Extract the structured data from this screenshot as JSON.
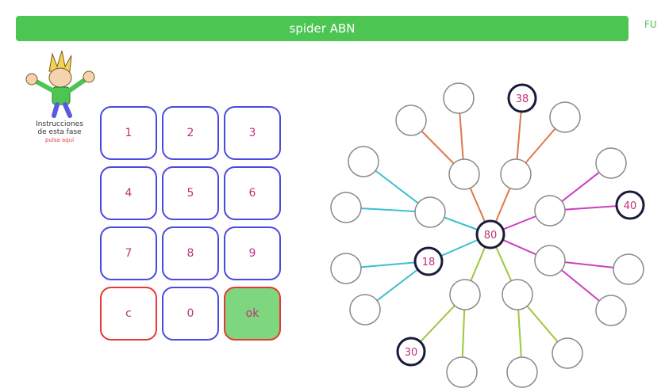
{
  "header": {
    "title": "spider ABN",
    "corner_label": "FU"
  },
  "instructions": {
    "line1": "Instrucciones",
    "line2": "de esta fase",
    "hint": "pulsa aquí"
  },
  "keypad": {
    "keys": [
      "1",
      "2",
      "3",
      "4",
      "5",
      "6",
      "7",
      "8",
      "9",
      "c",
      "0",
      "ok"
    ]
  },
  "spider": {
    "center": "80",
    "given": [
      "38",
      "40",
      "18",
      "30"
    ]
  },
  "colors": {
    "header_green": "#4cc553",
    "key_border_blue": "#4a4ae0",
    "key_border_red": "#e53935",
    "ok_fill": "#7ed67e",
    "digit_color": "#c0307a",
    "branch_orange": "#e0784a",
    "branch_magenta": "#cc3ec2",
    "branch_cyan": "#3cbfcf",
    "branch_lime": "#9cc83a"
  }
}
